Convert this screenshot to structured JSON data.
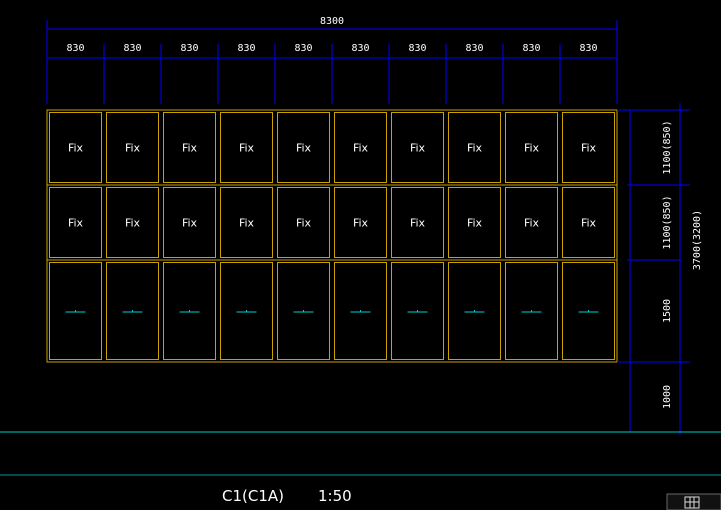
{
  "drawing": {
    "overall_width_label": "8300",
    "column_width_labels": [
      "830",
      "830",
      "830",
      "830",
      "830",
      "830",
      "830",
      "830",
      "830",
      "830"
    ],
    "row_labels": [
      {
        "text": "1100(850)"
      },
      {
        "text": "1100(850)"
      },
      {
        "text": "1500"
      }
    ],
    "overall_height_label": "3700(3200)",
    "sill_label": "1000",
    "pane_rows": [
      {
        "kind": "fixed",
        "label": "Fix"
      },
      {
        "kind": "fixed",
        "label": "Fix"
      },
      {
        "kind": "opening",
        "label": ""
      }
    ],
    "column_count": 10,
    "title": "C1(C1A)",
    "scale": "1:50",
    "colors": {
      "background": "#000000",
      "dimension": "#0000ff",
      "frame": "#c8a200",
      "ground": "#00c8c8",
      "opening_mark": "#00d0d0",
      "text": "#ffffff"
    }
  }
}
